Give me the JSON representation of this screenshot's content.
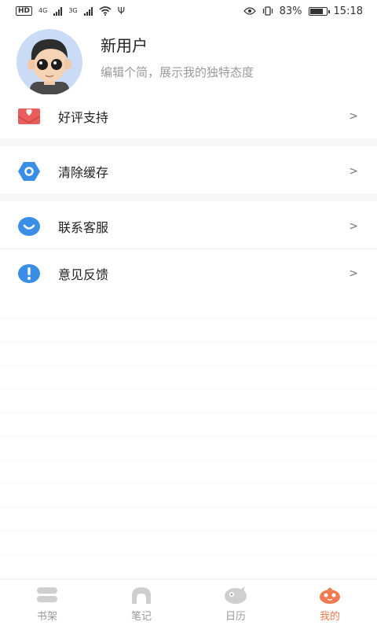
{
  "status_bar": {
    "hd": "HD",
    "net1": "4G",
    "net2": "3G",
    "battery_percent": "83%",
    "battery_level": 0.83,
    "time": "15:18"
  },
  "profile": {
    "username": "新用户",
    "bio": "编辑个简，展示我的独特态度"
  },
  "menu": [
    {
      "label": "好评支持",
      "icon": "heart-envelope-icon",
      "color": "#e95d5d"
    },
    {
      "label": "清除缓存",
      "icon": "hexagon-icon",
      "color": "#3a8ee6"
    },
    {
      "label": "联系客服",
      "icon": "chat-bubble-icon",
      "color": "#3a8ee6"
    },
    {
      "label": "意见反馈",
      "icon": "exclamation-icon",
      "color": "#3a8ee6"
    }
  ],
  "chevron": ">",
  "tabs": [
    {
      "label": "书架",
      "icon": "bookshelf-icon",
      "active": false
    },
    {
      "label": "笔记",
      "icon": "notes-icon",
      "active": false
    },
    {
      "label": "日历",
      "icon": "calendar-bird-icon",
      "active": false
    },
    {
      "label": "我的",
      "icon": "profile-bird-icon",
      "active": true
    }
  ],
  "colors": {
    "accent": "#f07b53",
    "inactive": "#999999",
    "icon_blue": "#3a8ee6"
  }
}
